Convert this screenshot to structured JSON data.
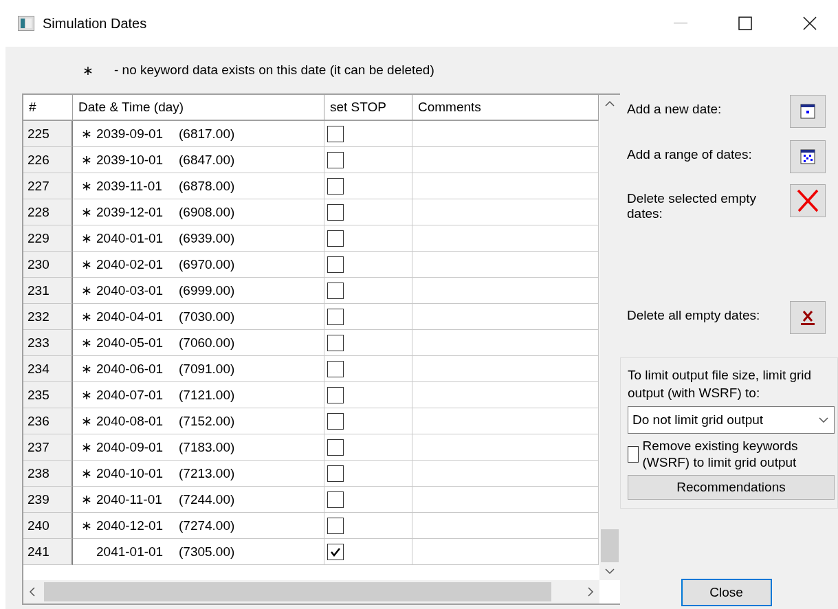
{
  "window": {
    "title": "Simulation Dates"
  },
  "legend": {
    "marker": "∗",
    "text": "- no keyword data exists on this date (it can be deleted)"
  },
  "table": {
    "columns": [
      "#",
      "Date & Time (day)",
      "set STOP",
      "Comments"
    ],
    "rows": [
      {
        "num": "225",
        "marker": "∗",
        "date": "2039-09-01",
        "days": "(6817.00)",
        "checked": false
      },
      {
        "num": "226",
        "marker": "∗",
        "date": "2039-10-01",
        "days": "(6847.00)",
        "checked": false
      },
      {
        "num": "227",
        "marker": "∗",
        "date": "2039-11-01",
        "days": "(6878.00)",
        "checked": false
      },
      {
        "num": "228",
        "marker": "∗",
        "date": "2039-12-01",
        "days": "(6908.00)",
        "checked": false
      },
      {
        "num": "229",
        "marker": "∗",
        "date": "2040-01-01",
        "days": "(6939.00)",
        "checked": false
      },
      {
        "num": "230",
        "marker": "∗",
        "date": "2040-02-01",
        "days": "(6970.00)",
        "checked": false
      },
      {
        "num": "231",
        "marker": "∗",
        "date": "2040-03-01",
        "days": "(6999.00)",
        "checked": false
      },
      {
        "num": "232",
        "marker": "∗",
        "date": "2040-04-01",
        "days": "(7030.00)",
        "checked": false
      },
      {
        "num": "233",
        "marker": "∗",
        "date": "2040-05-01",
        "days": "(7060.00)",
        "checked": false
      },
      {
        "num": "234",
        "marker": "∗",
        "date": "2040-06-01",
        "days": "(7091.00)",
        "checked": false
      },
      {
        "num": "235",
        "marker": "∗",
        "date": "2040-07-01",
        "days": "(7121.00)",
        "checked": false
      },
      {
        "num": "236",
        "marker": "∗",
        "date": "2040-08-01",
        "days": "(7152.00)",
        "checked": false
      },
      {
        "num": "237",
        "marker": "∗",
        "date": "2040-09-01",
        "days": "(7183.00)",
        "checked": false
      },
      {
        "num": "238",
        "marker": "∗",
        "date": "2040-10-01",
        "days": "(7213.00)",
        "checked": false
      },
      {
        "num": "239",
        "marker": "∗",
        "date": "2040-11-01",
        "days": "(7244.00)",
        "checked": false
      },
      {
        "num": "240",
        "marker": "∗",
        "date": "2040-12-01",
        "days": "(7274.00)",
        "checked": false
      },
      {
        "num": "241",
        "date": "2041-01-01",
        "days": "(7305.00)",
        "checked": true
      }
    ]
  },
  "actions": [
    {
      "kind": "add",
      "label": "Add a new date:"
    },
    {
      "kind": "range",
      "label": "Add a range of dates:"
    },
    {
      "kind": "delete",
      "label": "Delete selected empty dates:"
    },
    {
      "kind": "delete_all",
      "label": "Delete all empty dates:"
    }
  ],
  "output_limit": {
    "label": "To limit output file size, limit grid output (with WSRF) to:",
    "value": "Do not limit grid output",
    "remove_label": "Remove existing keywords (WSRF) to limit grid output",
    "remove_checked": false,
    "button": "Recommendations"
  },
  "close_button": "Close"
}
